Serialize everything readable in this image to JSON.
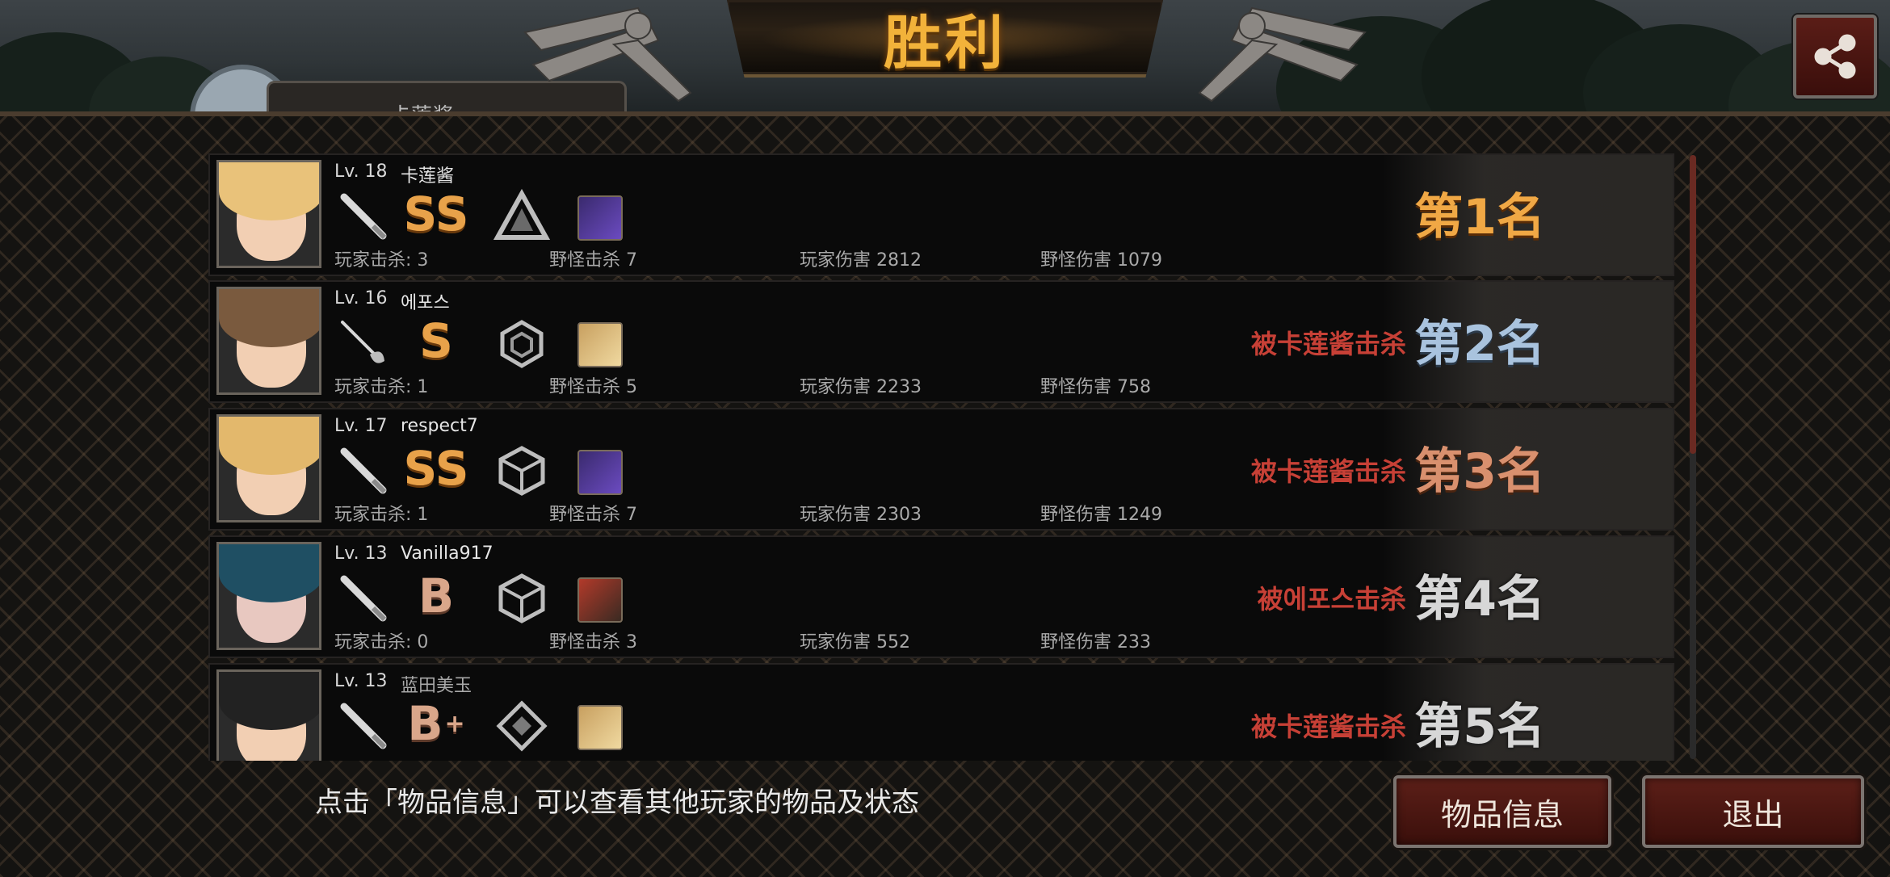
{
  "header": {
    "title": "胜利",
    "partial_player_name": "卡莲酱"
  },
  "players": [
    {
      "level": "Lv. 18",
      "name": "卡莲酱",
      "grade": "SS",
      "killed_by": "",
      "placement": "第1名",
      "player_kills": "玩家击杀: 3",
      "monster_kills": "野怪击杀 7",
      "player_damage": "玩家伤害 2812",
      "monster_damage": "野怪伤害 1079"
    },
    {
      "level": "Lv. 16",
      "name": "에포스",
      "grade": "S",
      "killed_by": "被卡莲酱击杀",
      "placement": "第2名",
      "player_kills": "玩家击杀: 1",
      "monster_kills": "野怪击杀 5",
      "player_damage": "玩家伤害 2233",
      "monster_damage": "野怪伤害 758"
    },
    {
      "level": "Lv. 17",
      "name": "respect7",
      "grade": "SS",
      "killed_by": "被卡莲酱击杀",
      "placement": "第3名",
      "player_kills": "玩家击杀: 1",
      "monster_kills": "野怪击杀 7",
      "player_damage": "玩家伤害 2303",
      "monster_damage": "野怪伤害 1249"
    },
    {
      "level": "Lv. 13",
      "name": "Vanilla917",
      "grade": "B",
      "killed_by": "被에포스击杀",
      "placement": "第4名",
      "player_kills": "玩家击杀: 0",
      "monster_kills": "野怪击杀 3",
      "player_damage": "玩家伤害 552",
      "monster_damage": "野怪伤害 233"
    },
    {
      "level": "Lv. 13",
      "name": "蓝田美玉",
      "grade": "B",
      "grade_plus": "+",
      "killed_by": "被卡莲酱击杀",
      "placement": "第5名"
    }
  ],
  "footer": {
    "hint": "点击「物品信息」可以查看其他玩家的物品及状态",
    "item_info_button": "物品信息",
    "exit_button": "退出"
  },
  "icons": {
    "share": "share-icon",
    "weapons": [
      "bat-weapon-icon",
      "rapier-weapon-icon",
      "bat-weapon-icon",
      "bat-weapon-icon",
      "bat-weapon-icon"
    ],
    "emblems": [
      "triangle-emblem-icon",
      "hexagon-emblem-icon",
      "cube-emblem-icon",
      "cube-emblem-icon",
      "diamond-emblem-icon"
    ],
    "items": [
      "purple-item-icon",
      "gold-item-icon",
      "purple-item-icon",
      "portrait-item-icon",
      "gold-item-icon"
    ]
  },
  "colors": {
    "gold": "#f0a845",
    "killed_red": "#c74036",
    "button_red": "#5c1f18"
  }
}
